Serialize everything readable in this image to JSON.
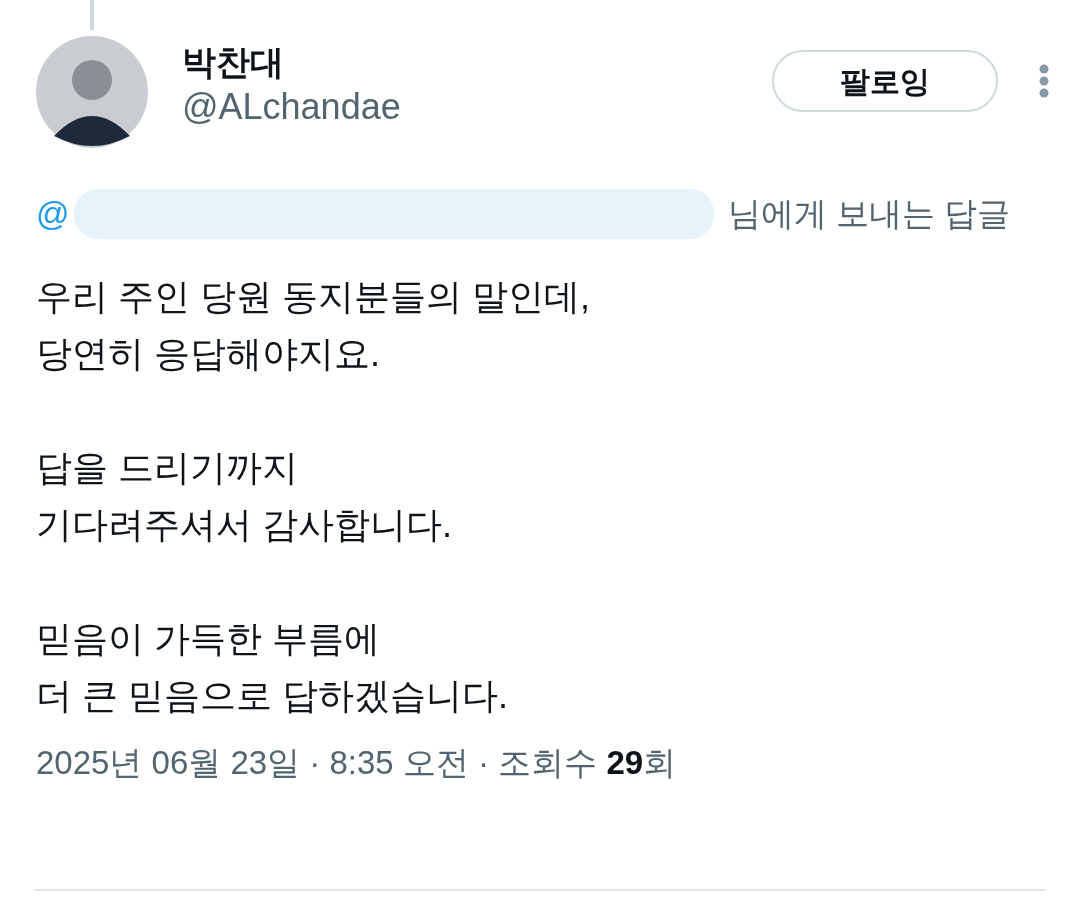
{
  "author": {
    "name": "박찬대",
    "handle": "@ALchandae"
  },
  "follow_button": {
    "label": "팔로잉"
  },
  "reply_to": {
    "visible_prefix": "@",
    "suffix": "님에게 보내는 답글"
  },
  "body": [
    "우리 주인 당원 동지분들의 말인데,\n당연히 응답해야지요.",
    "답을 드리기까지\n기다려주셔서 감사합니다.",
    "믿음이 가득한 부름에\n더 큰 믿음으로 답하겠습니다."
  ],
  "meta": "2025년 06월 23일 · 8:35 오전 · 조회수 **29**회"
}
